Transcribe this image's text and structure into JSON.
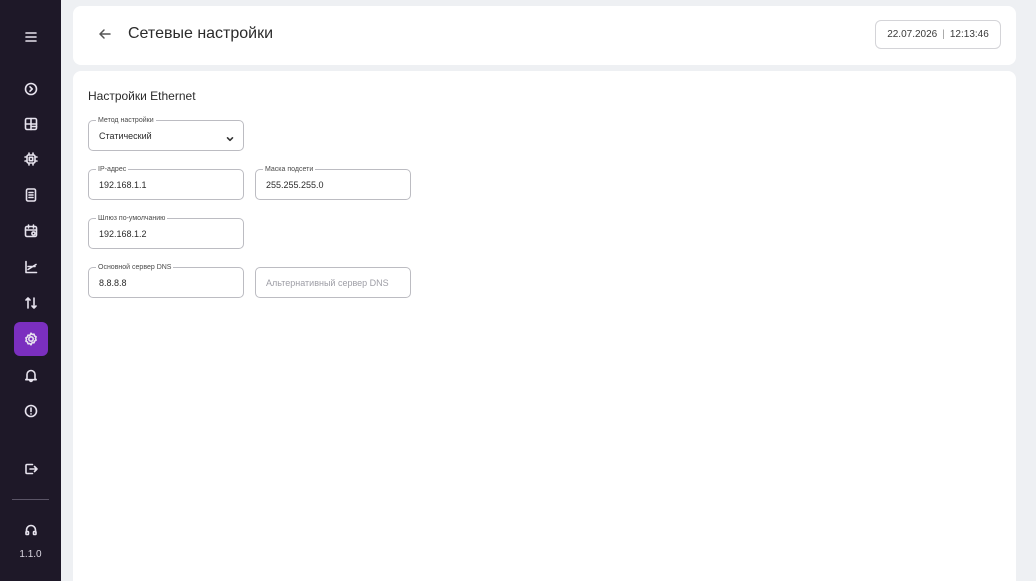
{
  "sidebar": {
    "items": [
      {
        "icon": "menu-icon"
      },
      {
        "icon": "play-circle-icon"
      },
      {
        "icon": "dashboard-icon"
      },
      {
        "icon": "chip-icon"
      },
      {
        "icon": "document-icon"
      },
      {
        "icon": "calendar-icon"
      },
      {
        "icon": "chart-icon"
      },
      {
        "icon": "transfer-icon"
      },
      {
        "icon": "settings-icon",
        "active": true
      },
      {
        "icon": "bell-icon"
      },
      {
        "icon": "alert-icon"
      },
      {
        "icon": "logout-icon"
      },
      {
        "icon": "headset-icon"
      }
    ],
    "version": "1.1.0",
    "active_color": "#7b2fbf",
    "background": "#1e1828"
  },
  "header": {
    "title": "Сетевые настройки",
    "date": "22.07.2026",
    "separator": "|",
    "time": "12:13:46"
  },
  "ethernet": {
    "section_title": "Настройки Ethernet",
    "method": {
      "label": "Метод настройки",
      "value": "Статический"
    },
    "ip": {
      "label": "IP-адрес",
      "value": "192.168.1.1"
    },
    "mask": {
      "label": "Маска подсети",
      "value": "255.255.255.0"
    },
    "gateway": {
      "label": "Шлюз по-умолчанию",
      "value": "192.168.1.2"
    },
    "dns_primary": {
      "label": "Основной сервер DNS",
      "value": "8.8.8.8"
    },
    "dns_secondary": {
      "placeholder": "Альтернативный сервер DNS",
      "value": ""
    }
  }
}
